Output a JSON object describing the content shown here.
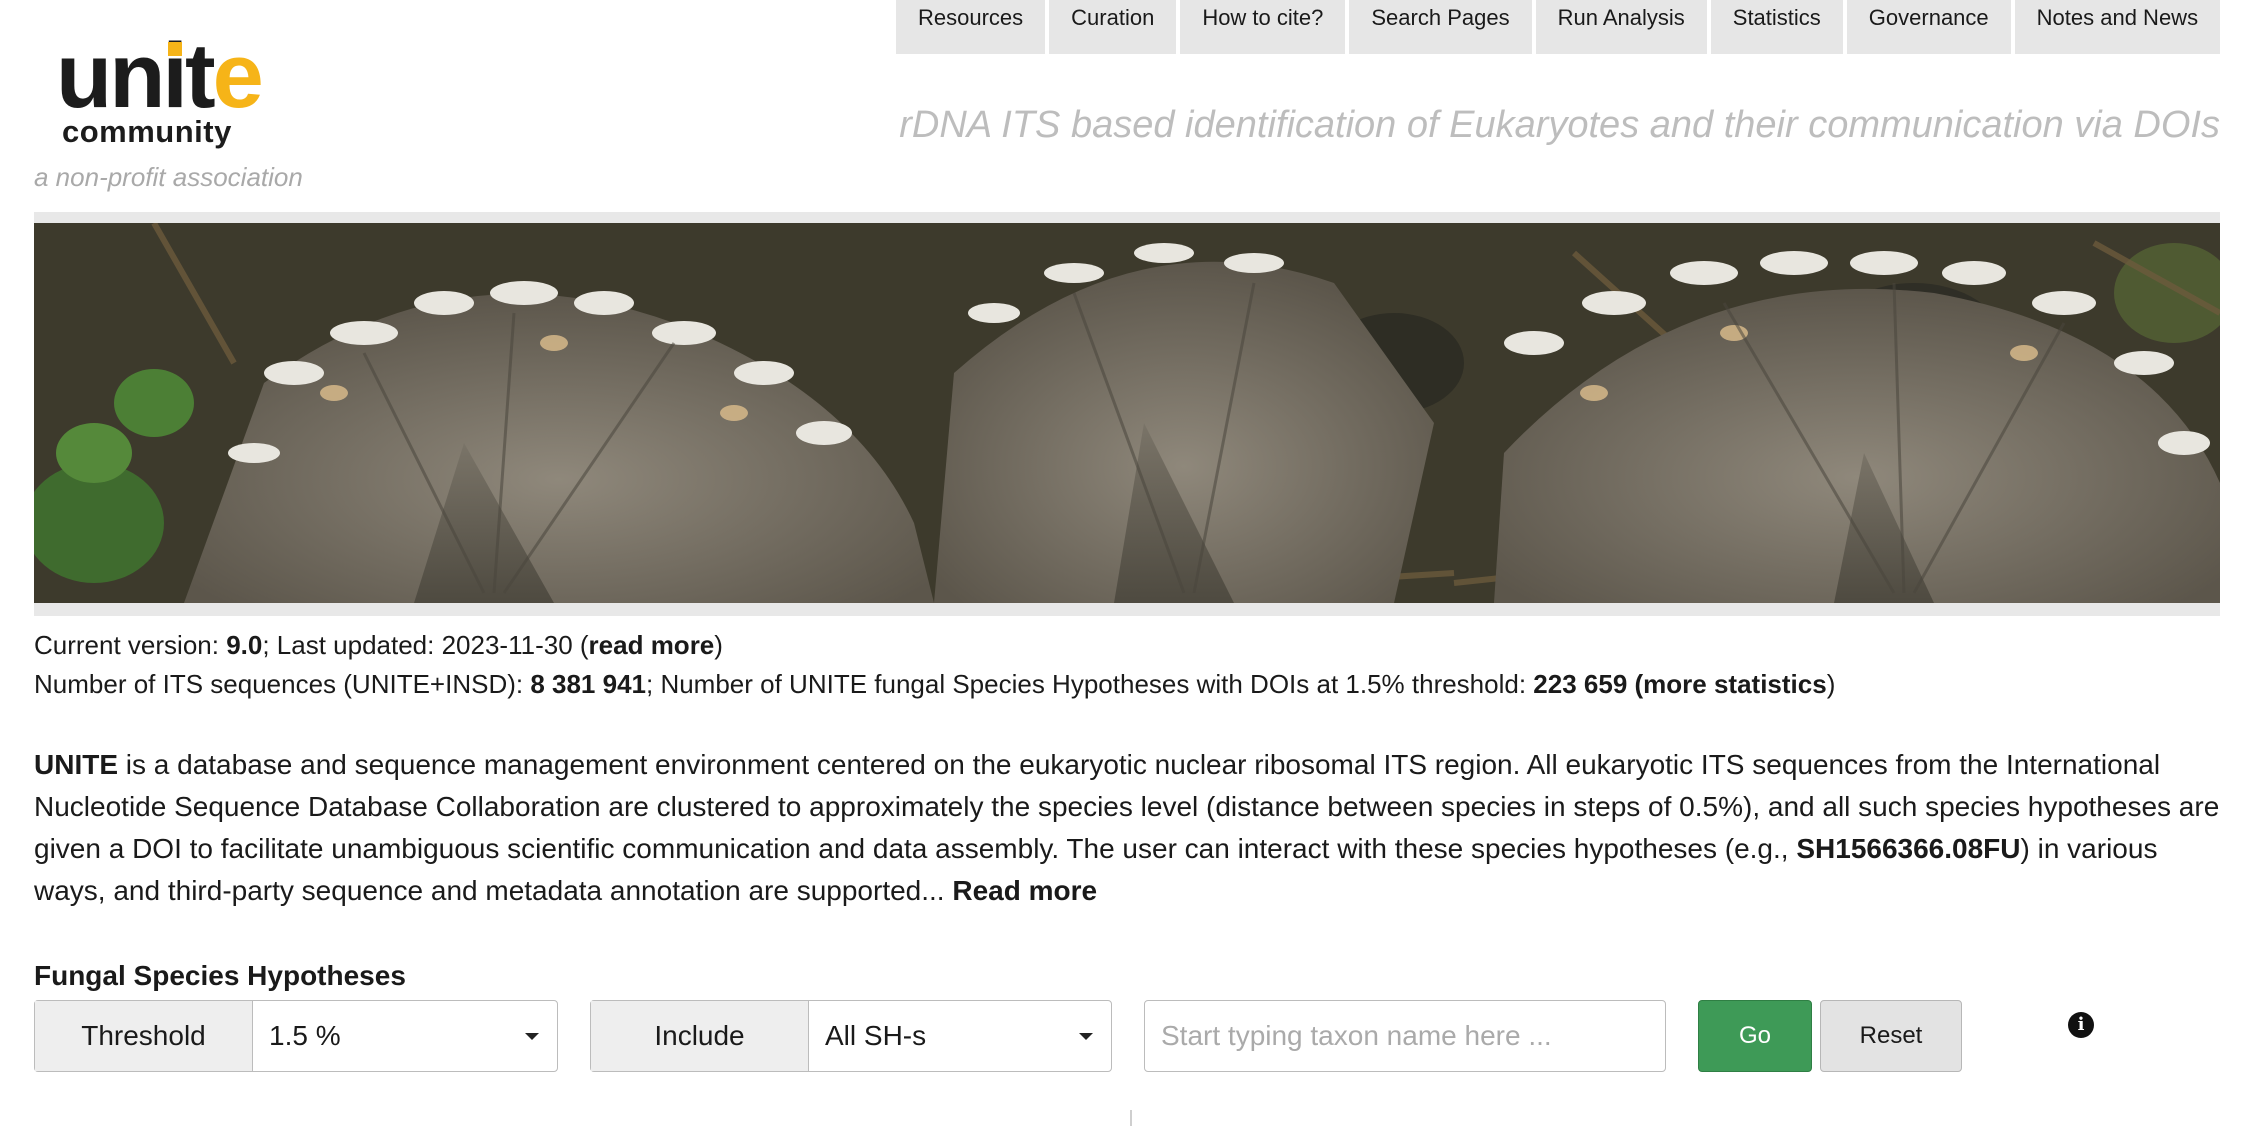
{
  "nav": {
    "items": [
      {
        "label": "Resources"
      },
      {
        "label": "Curation"
      },
      {
        "label": "How to cite?"
      },
      {
        "label": "Search Pages"
      },
      {
        "label": "Run Analysis"
      },
      {
        "label": "Statistics"
      },
      {
        "label": "Governance"
      },
      {
        "label": "Notes and News"
      }
    ]
  },
  "logo": {
    "word_part1": "unit",
    "word_part2": "e",
    "community": "community",
    "colors": {
      "accent": "#f6b418",
      "text": "#1c1c1c"
    }
  },
  "header": {
    "tagline_left": "a non-profit association",
    "tagline_right": "rDNA ITS based identification of Eukaryotes and their communication via DOIs"
  },
  "info": {
    "version_prefix": "Current version: ",
    "version": "9.0",
    "updated_prefix": "; Last updated: 2023-11-30 (",
    "read_more": "read more",
    "updated_suffix": ")",
    "seq_prefix": "Number of ITS sequences (UNITE+INSD): ",
    "seq_count": "8 381 941",
    "sh_prefix": "; Number of UNITE fungal Species Hypotheses with DOIs at 1.5% threshold: ",
    "sh_count": "223 659",
    "stats_open": " (",
    "more_statistics": "more statistics",
    "stats_close": ")"
  },
  "about": {
    "name": "UNITE",
    "text1": " is a database and sequence management environment centered on the eukaryotic nuclear ribosomal ITS region. All eukaryotic ITS sequences from the International Nucleotide Sequence Database Collaboration are clustered to approximately the species level (distance between species in steps of 0.5%), and all such species hypotheses are given a DOI to facilitate unambiguous scientific communication and data assembly. The user can interact with these species hypotheses (e.g., ",
    "example_sh": "SH1566366.08FU",
    "text2": ") in various ways, and third-party sequence and metadata annotation are supported... ",
    "read_more": "Read more"
  },
  "search": {
    "title": "Fungal Species Hypotheses",
    "threshold_label": "Threshold",
    "threshold_value": "1.5 %",
    "include_label": "Include",
    "include_value": "All SH-s",
    "taxon_placeholder": "Start typing taxon name here ...",
    "go_label": "Go",
    "reset_label": "Reset",
    "info_icon": "info-circle-icon",
    "colors": {
      "go": "#3e9a57"
    }
  }
}
